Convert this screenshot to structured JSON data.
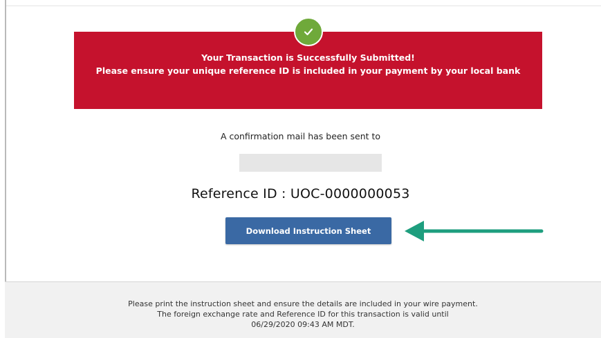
{
  "banner": {
    "line1": "Your Transaction is Successfully Submitted!",
    "line2": "Please ensure your unique reference ID is included in your payment by your local bank",
    "icon": "check-icon",
    "bg_color": "#c5122d",
    "check_color": "#6fa93a"
  },
  "confirmation": {
    "mail_text": "A confirmation mail has been sent to"
  },
  "reference": {
    "text": "Reference ID : UOC-0000000053"
  },
  "download_button": {
    "label": "Download Instruction Sheet",
    "color": "#3a69a4"
  },
  "annotation": {
    "icon": "arrow-left-icon",
    "color": "#1e9e7e"
  },
  "footer": {
    "line1": "Please print the instruction sheet and ensure the details are included in your wire payment.",
    "line2": "The foreign exchange rate and Reference ID for this transaction is valid until",
    "line3": "06/29/2020 09:43 AM MDT."
  }
}
